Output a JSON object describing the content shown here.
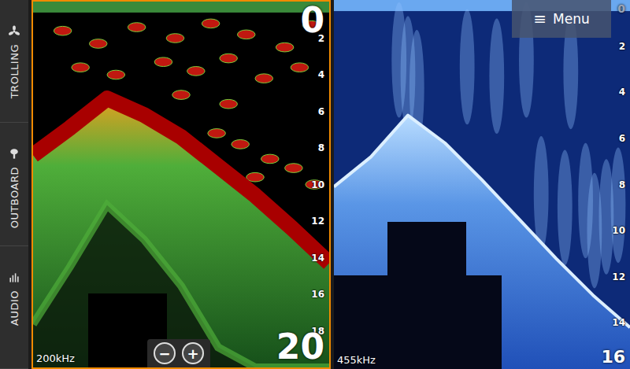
{
  "sidebar": {
    "items": [
      {
        "label": "TROLLING"
      },
      {
        "label": "OUTBOARD"
      },
      {
        "label": "AUDIO"
      }
    ]
  },
  "panes": [
    {
      "frequency": "200kHz",
      "selected": true,
      "range_top": "0",
      "range_bottom": "20",
      "max_depth": 20,
      "ticks": [
        "2",
        "4",
        "6",
        "8",
        "10",
        "12",
        "14",
        "16",
        "18"
      ],
      "bottom": [
        8.4,
        6.9,
        5.3,
        6.2,
        7.4,
        9.0,
        10.6,
        12.4,
        14.3
      ],
      "zoom": {
        "out": "−",
        "in": "+"
      }
    },
    {
      "frequency": "455kHz",
      "selected": false,
      "range_top": "0",
      "range_bottom": "16",
      "max_depth": 16,
      "ticks": [
        "2",
        "4",
        "6",
        "8",
        "10",
        "12",
        "14"
      ],
      "bottom": [
        8.1,
        6.8,
        5.0,
        6.2,
        7.8,
        9.5,
        11.2,
        12.8,
        14.2
      ],
      "menu": {
        "icon": "≡",
        "label": "Menu"
      }
    }
  ]
}
